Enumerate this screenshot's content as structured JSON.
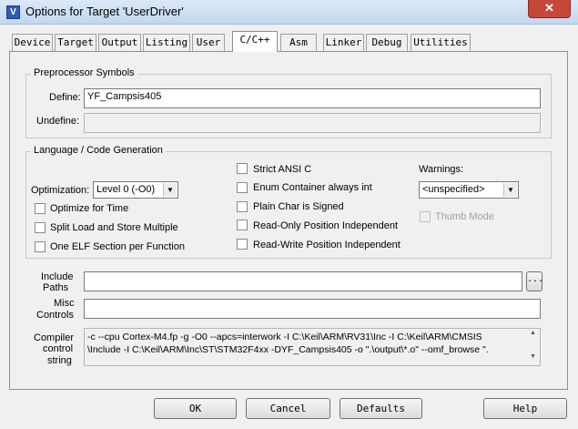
{
  "window": {
    "title": "Options for Target 'UserDriver'",
    "close_glyph": "✕",
    "app_icon_glyph": "V"
  },
  "tabs": [
    "Device",
    "Target",
    "Output",
    "Listing",
    "User",
    "C/C++",
    "Asm",
    "Linker",
    "Debug",
    "Utilities"
  ],
  "active_tab": "C/C++",
  "preprocessor": {
    "group_label": "Preprocessor Symbols",
    "define_label": "Define:",
    "define_value": "YF_Campsis405",
    "undefine_label": "Undefine:",
    "undefine_value": ""
  },
  "language": {
    "group_label": "Language / Code Generation",
    "optimization_label": "Optimization:",
    "optimization_value": "Level 0 (-O0)",
    "checkboxes_left": [
      {
        "label": "Optimize for Time",
        "checked": false
      },
      {
        "label": "Split Load and Store Multiple",
        "checked": false
      },
      {
        "label": "One ELF Section per Function",
        "checked": false
      }
    ],
    "checkboxes_mid": [
      {
        "label": "Strict ANSI C",
        "checked": false
      },
      {
        "label": "Enum Container always int",
        "checked": false
      },
      {
        "label": "Plain Char is Signed",
        "checked": false
      },
      {
        "label": "Read-Only Position Independent",
        "checked": false
      },
      {
        "label": "Read-Write Position Independent",
        "checked": false
      }
    ],
    "warnings_label": "Warnings:",
    "warnings_value": "<unspecified>",
    "thumb_mode_label": "Thumb Mode",
    "thumb_mode_enabled": false
  },
  "paths": {
    "include_label_1": "Include",
    "include_label_2": "Paths",
    "include_value": "",
    "browse_label": "...",
    "misc_label_1": "Misc",
    "misc_label_2": "Controls",
    "misc_value": ""
  },
  "compiler": {
    "label_1": "Compiler",
    "label_2": "control",
    "label_3": "string",
    "line_1": "-c --cpu Cortex-M4.fp -g -O0 --apcs=interwork -I C:\\Keil\\ARM\\RV31\\Inc -I C:\\Keil\\ARM\\CMSIS",
    "line_2": "\\Include -I C:\\Keil\\ARM\\Inc\\ST\\STM32F4xx -DYF_Campsis405 -o \".\\output\\*.o\" --omf_browse \"."
  },
  "buttons": {
    "ok": "OK",
    "cancel": "Cancel",
    "defaults": "Defaults",
    "help": "Help"
  },
  "icons": {
    "dropdown": "▼",
    "scroll_up": "▲",
    "scroll_down": "▼"
  }
}
